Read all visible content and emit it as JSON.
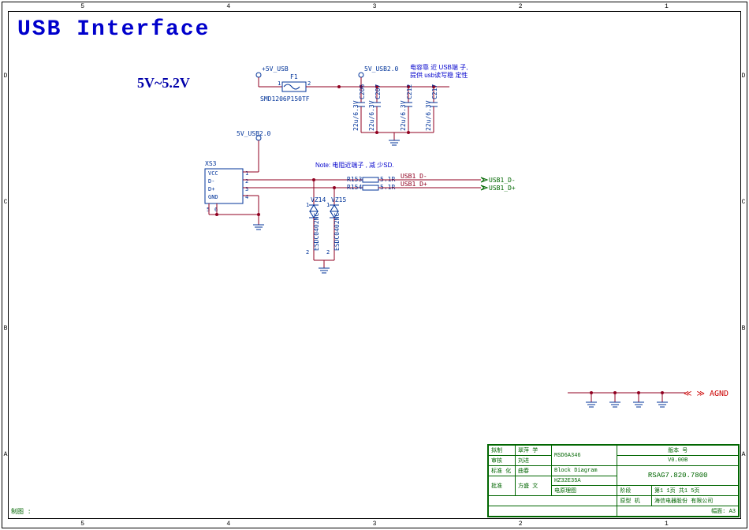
{
  "ruler": {
    "top": [
      "5",
      "4",
      "3",
      "2",
      "1"
    ],
    "bottom": [
      "5",
      "4",
      "3",
      "2",
      "1"
    ],
    "left": [
      "D",
      "C",
      "B",
      "A"
    ],
    "right": [
      "D",
      "C",
      "B",
      "A"
    ]
  },
  "title": "USB Interface",
  "voltage_note": "5V~5.2V",
  "nets": {
    "pwr5v_usb": "+5V_USB",
    "pwr5v_usb20_a": "5V_USB2.0",
    "pwr5v_usb20_b": "5V_USB2.0",
    "usb1_dm": "USB1_D-",
    "usb1_dp": "USB1_D+",
    "usb1_dm_out": "USB1_D-",
    "usb1_dp_out": "USB1_D+",
    "agnd": "AGND"
  },
  "notes": {
    "cap_line1": "电容靠 近 USB端 子,",
    "cap_line2": "提供 usb读写稳 定性",
    "res_note": "Note: 电阻近端子 , 减 少SD."
  },
  "components": {
    "F1": {
      "ref": "F1",
      "val": "SMD1206P150TF",
      "pin1": "1",
      "pin2": "2"
    },
    "C206": {
      "ref": "C206",
      "val": "22u/6.3V"
    },
    "C207": {
      "ref": "C207",
      "val": "22u/6.3V"
    },
    "C212": {
      "ref": "C212",
      "val": "22u/6.3V"
    },
    "C217": {
      "ref": "C217",
      "val": "22u/6.3V"
    },
    "R153": {
      "ref": "R153",
      "val": "5.1R"
    },
    "R154": {
      "ref": "R154",
      "val": "5.1R"
    },
    "VZ14": {
      "ref": "VZ14",
      "val": "ESDC0402NC",
      "pin1": "1",
      "pin2": "2"
    },
    "VZ15": {
      "ref": "VZ15",
      "val": "ESDC0402NC",
      "pin1": "1",
      "pin2": "2"
    },
    "XS3": {
      "ref": "XS3",
      "pins": {
        "p1": "1",
        "p2": "2",
        "p3": "3",
        "p4": "4",
        "p5": "5",
        "p6": "6"
      },
      "labels": {
        "vcc": "VCC",
        "dm": "D-",
        "dp": "D+",
        "gnd": "GND"
      }
    }
  },
  "title_block": {
    "row1": {
      "l1": "拟制",
      "v1": "翠萍 学",
      "mid": "MSD6A346",
      "r1": "版本 号"
    },
    "row2": {
      "l1": "审核",
      "v1": "刘进",
      "mid2": "Block Diagram",
      "r1": "V0.00B"
    },
    "row3": {
      "l1": "标准 化",
      "v1": "曲春"
    },
    "row4": {
      "l1": "批准",
      "v1": "方盛 文",
      "mid": "HZ32E35A",
      "mid2": "电原理图",
      "r1": "RSAG7.820.7800"
    },
    "row5": {
      "r1": "阶段",
      "r2": "第1 1页  共1 5页"
    },
    "row6": {
      "r1": "原型 机",
      "r2": "海信电器股份 有限公司"
    },
    "row7": {
      "r2": "幅面:  A3"
    },
    "drawn_by": "制图 :"
  }
}
